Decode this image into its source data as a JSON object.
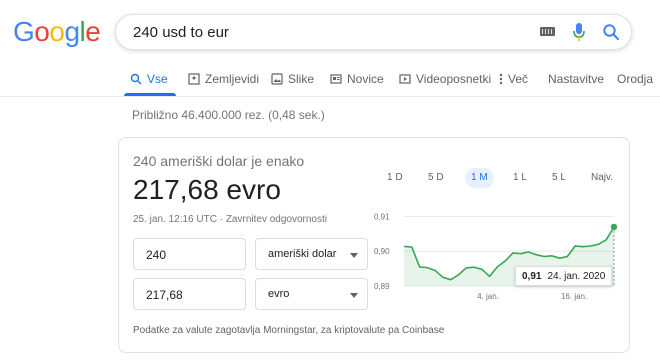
{
  "logo": {
    "letters": [
      "G",
      "o",
      "o",
      "g",
      "l",
      "e"
    ]
  },
  "search": {
    "query": "240 usd to eur"
  },
  "tabs": [
    {
      "label": "Vse",
      "icon": "search-icon",
      "active": true
    },
    {
      "label": "Zemljevidi",
      "icon": "map-pin-icon"
    },
    {
      "label": "Slike",
      "icon": "image-icon"
    },
    {
      "label": "Novice",
      "icon": "news-icon"
    },
    {
      "label": "Videoposnetki",
      "icon": "video-icon"
    },
    {
      "label": "Več",
      "icon": "more-vert-icon"
    },
    {
      "label": "Nastavitve"
    },
    {
      "label": "Orodja"
    }
  ],
  "stats": "Približno 46.400.000 rez. (0,48 sek.)",
  "converter": {
    "equals_label": "240 ameriški dolar je enako",
    "result": "217,68 evro",
    "timestamp": "25. jan. 12:16 UTC · Zavrnitev odgovornosti",
    "from_amount": "240",
    "from_currency": "ameriški dolar",
    "to_amount": "217,68",
    "to_currency": "evro",
    "source": "Podatke za valute zagotavlja Morningstar, za kriptovalute pa Coinbase"
  },
  "ranges": [
    "1 D",
    "5 D",
    "1 M",
    "1 L",
    "5 L",
    "Najv."
  ],
  "active_range": "1 M",
  "tooltip": {
    "value": "0,91",
    "date": "24. jan. 2020"
  },
  "chart_data": {
    "type": "area",
    "color": "#34a853",
    "y_ticks": [
      "0,91",
      "0,90",
      "0,89"
    ],
    "x_ticks": [
      "4. jan.",
      "16. jan."
    ],
    "ylim": [
      0.89,
      0.911
    ],
    "values": [
      0.9014,
      0.9012,
      0.8955,
      0.8953,
      0.8945,
      0.8925,
      0.8918,
      0.8932,
      0.8952,
      0.8954,
      0.8948,
      0.8928,
      0.8955,
      0.8972,
      0.8995,
      0.8993,
      0.8998,
      0.899,
      0.8985,
      0.8987,
      0.898,
      0.8985,
      0.9015,
      0.9013,
      0.9015,
      0.902,
      0.9033,
      0.907
    ]
  }
}
